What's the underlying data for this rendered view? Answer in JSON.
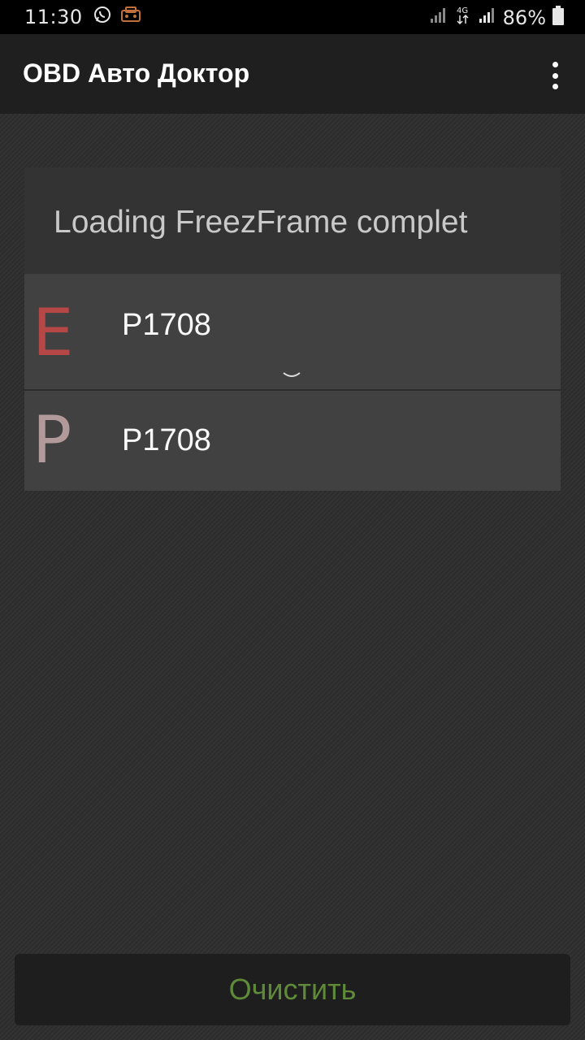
{
  "status_bar": {
    "time": "11:30",
    "icons_left": [
      "whatsapp-icon",
      "car-notification-icon"
    ],
    "icons_right": [
      "signal-icon",
      "4g-icon",
      "signal-icon-2",
      "battery-icon"
    ],
    "network_label": "4G",
    "battery": "86%"
  },
  "toolbar": {
    "title": "OBD Авто Доктор",
    "overflow_icon": "more-vert-icon"
  },
  "card": {
    "header": "Loading FreezFrame complet",
    "rows": [
      {
        "letter": "E",
        "code": "P1708",
        "letter_color": "#b64747",
        "expandable": true
      },
      {
        "letter": "P",
        "code": "P1708",
        "letter_color": "#b39a9a",
        "expandable": false
      }
    ]
  },
  "clear_button": {
    "label": "Очистить",
    "color": "#5e8a39"
  }
}
